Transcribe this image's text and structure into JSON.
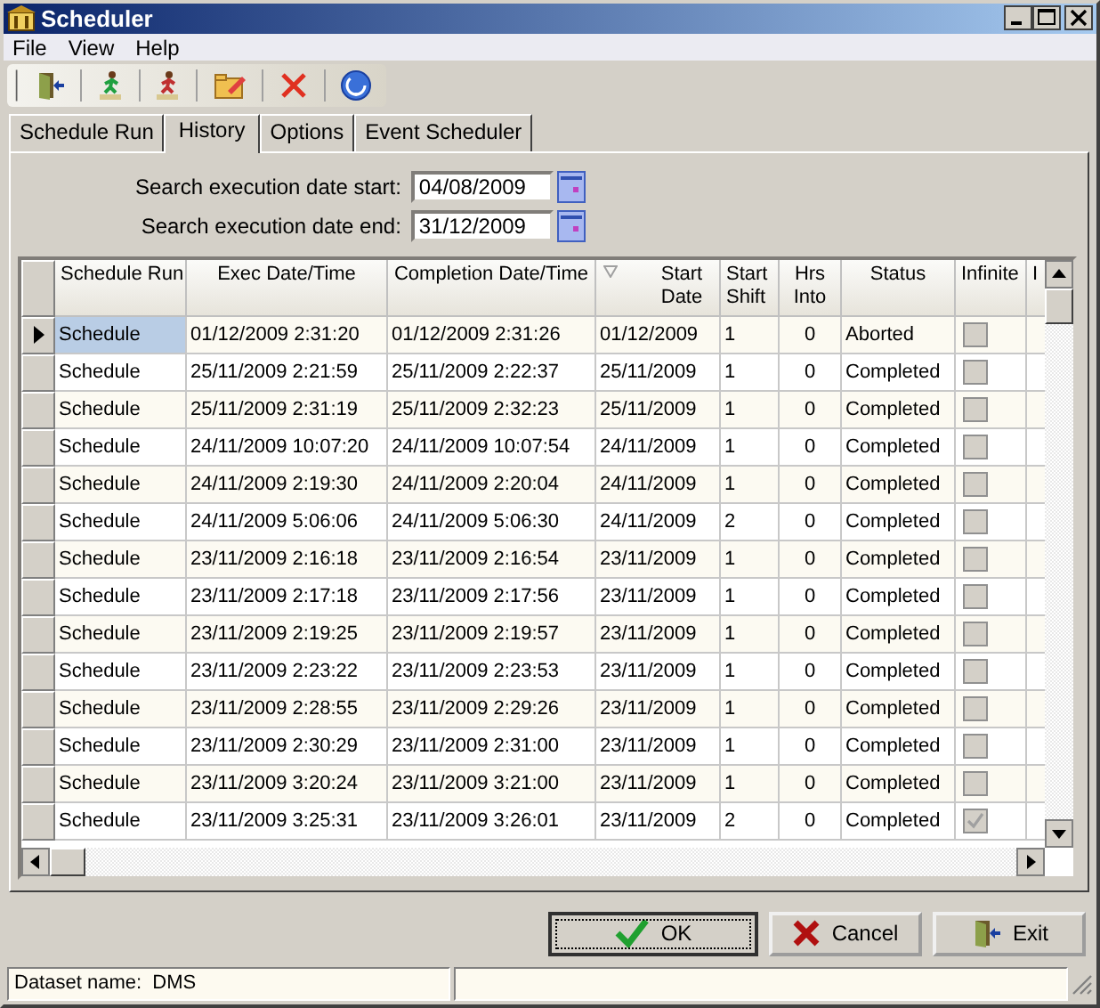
{
  "window": {
    "title": "Scheduler"
  },
  "menu": [
    "File",
    "View",
    "Help"
  ],
  "tabs": [
    {
      "label": "Schedule Run",
      "selected": false
    },
    {
      "label": "History",
      "selected": true
    },
    {
      "label": "Options",
      "selected": false
    },
    {
      "label": "Event Scheduler",
      "selected": false
    }
  ],
  "filters": [
    {
      "label": "Search execution date start:",
      "value": "04/08/2009"
    },
    {
      "label": "Search execution date end:",
      "value": "31/12/2009"
    }
  ],
  "table": {
    "columns": [
      {
        "label": "Schedule Run",
        "sorted": false
      },
      {
        "label": "Exec Date/Time",
        "sorted": false
      },
      {
        "label": "Completion Date/Time",
        "sorted": false
      },
      {
        "label": "Start Date",
        "sorted": true
      },
      {
        "label": "Start Shift",
        "sorted": false
      },
      {
        "label": "Hrs Into",
        "sorted": false
      },
      {
        "label": "Status",
        "sorted": false
      },
      {
        "label": "Infinite",
        "sorted": false
      },
      {
        "label": "I",
        "sorted": false
      }
    ],
    "rows": [
      {
        "selected": true,
        "run": "Schedule",
        "exec": "01/12/2009 2:31:20",
        "completion": "01/12/2009 2:31:26",
        "start_date": "01/12/2009",
        "shift": "1",
        "hrs": "0",
        "status": "Aborted",
        "infinite": false
      },
      {
        "selected": false,
        "run": "Schedule",
        "exec": "25/11/2009 2:21:59",
        "completion": "25/11/2009 2:22:37",
        "start_date": "25/11/2009",
        "shift": "1",
        "hrs": "0",
        "status": "Completed",
        "infinite": false
      },
      {
        "selected": false,
        "run": "Schedule",
        "exec": "25/11/2009 2:31:19",
        "completion": "25/11/2009 2:32:23",
        "start_date": "25/11/2009",
        "shift": "1",
        "hrs": "0",
        "status": "Completed",
        "infinite": false
      },
      {
        "selected": false,
        "run": "Schedule",
        "exec": "24/11/2009 10:07:20",
        "completion": "24/11/2009 10:07:54",
        "start_date": "24/11/2009",
        "shift": "1",
        "hrs": "0",
        "status": "Completed",
        "infinite": false
      },
      {
        "selected": false,
        "run": "Schedule",
        "exec": "24/11/2009 2:19:30",
        "completion": "24/11/2009 2:20:04",
        "start_date": "24/11/2009",
        "shift": "1",
        "hrs": "0",
        "status": "Completed",
        "infinite": false
      },
      {
        "selected": false,
        "run": "Schedule",
        "exec": "24/11/2009 5:06:06",
        "completion": "24/11/2009 5:06:30",
        "start_date": "24/11/2009",
        "shift": "2",
        "hrs": "0",
        "status": "Completed",
        "infinite": false
      },
      {
        "selected": false,
        "run": "Schedule",
        "exec": "23/11/2009 2:16:18",
        "completion": "23/11/2009 2:16:54",
        "start_date": "23/11/2009",
        "shift": "1",
        "hrs": "0",
        "status": "Completed",
        "infinite": false
      },
      {
        "selected": false,
        "run": "Schedule",
        "exec": "23/11/2009 2:17:18",
        "completion": "23/11/2009 2:17:56",
        "start_date": "23/11/2009",
        "shift": "1",
        "hrs": "0",
        "status": "Completed",
        "infinite": false
      },
      {
        "selected": false,
        "run": "Schedule",
        "exec": "23/11/2009 2:19:25",
        "completion": "23/11/2009 2:19:57",
        "start_date": "23/11/2009",
        "shift": "1",
        "hrs": "0",
        "status": "Completed",
        "infinite": false
      },
      {
        "selected": false,
        "run": "Schedule",
        "exec": "23/11/2009 2:23:22",
        "completion": "23/11/2009 2:23:53",
        "start_date": "23/11/2009",
        "shift": "1",
        "hrs": "0",
        "status": "Completed",
        "infinite": false
      },
      {
        "selected": false,
        "run": "Schedule",
        "exec": "23/11/2009 2:28:55",
        "completion": "23/11/2009 2:29:26",
        "start_date": "23/11/2009",
        "shift": "1",
        "hrs": "0",
        "status": "Completed",
        "infinite": false
      },
      {
        "selected": false,
        "run": "Schedule",
        "exec": "23/11/2009 2:30:29",
        "completion": "23/11/2009 2:31:00",
        "start_date": "23/11/2009",
        "shift": "1",
        "hrs": "0",
        "status": "Completed",
        "infinite": false
      },
      {
        "selected": false,
        "run": "Schedule",
        "exec": "23/11/2009 3:20:24",
        "completion": "23/11/2009 3:21:00",
        "start_date": "23/11/2009",
        "shift": "1",
        "hrs": "0",
        "status": "Completed",
        "infinite": false
      },
      {
        "selected": false,
        "run": "Schedule",
        "exec": "23/11/2009 3:25:31",
        "completion": "23/11/2009 3:26:01",
        "start_date": "23/11/2009",
        "shift": "2",
        "hrs": "0",
        "status": "Completed",
        "infinite": true
      }
    ]
  },
  "buttons": [
    {
      "kind": "ok",
      "label": "OK",
      "focused": true
    },
    {
      "kind": "cancel",
      "label": "Cancel",
      "focused": false
    },
    {
      "kind": "exit",
      "label": "Exit",
      "focused": false
    }
  ],
  "status_bar": {
    "text": "Dataset name:  DMS"
  }
}
